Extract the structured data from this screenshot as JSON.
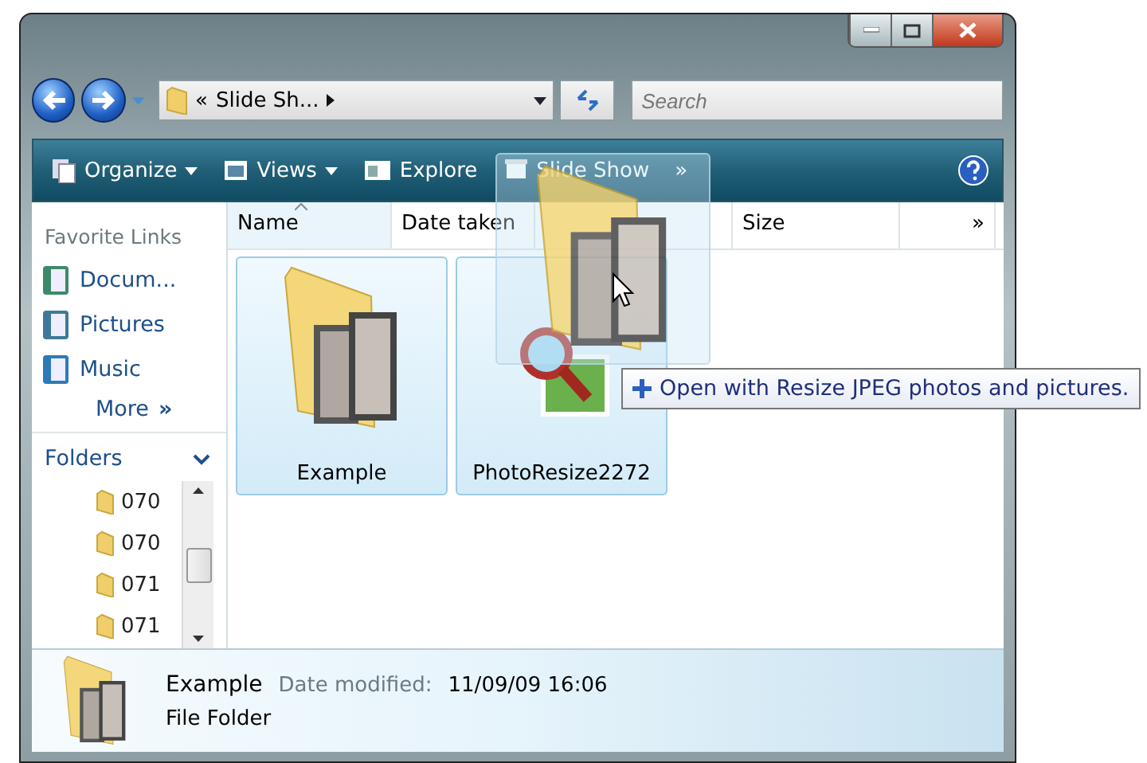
{
  "address": {
    "overflow": "«",
    "crumb": "Slide Sh...",
    "placeholder": "Search"
  },
  "toolbar": {
    "buttons": [
      {
        "label": "Organize",
        "kind": "organize",
        "dropdown": true
      },
      {
        "label": "Views",
        "kind": "views",
        "dropdown": true
      },
      {
        "label": "Explore",
        "kind": "explore",
        "dropdown": false
      },
      {
        "label": "Slide Show",
        "kind": "slideshow",
        "dropdown": false
      }
    ],
    "more": "»"
  },
  "favorite_links": {
    "title": "Favorite Links",
    "items": [
      {
        "label": "Docum...",
        "kind": "documents"
      },
      {
        "label": "Pictures",
        "kind": "pictures"
      },
      {
        "label": "Music",
        "kind": "music"
      }
    ],
    "more": "More",
    "more_glyph": "»"
  },
  "folders": {
    "title": "Folders",
    "expanded": true,
    "items": [
      "070",
      "070",
      "071",
      "071"
    ]
  },
  "columns": [
    {
      "label": "Name",
      "sorted": true
    },
    {
      "label": "Date taken",
      "sorted": false
    },
    {
      "label": "Size",
      "sorted": false
    }
  ],
  "columns_more": "»",
  "items": [
    {
      "name": "Example",
      "kind": "folder",
      "selected": true
    },
    {
      "name": "PhotoResize2272",
      "kind": "program",
      "selected": true
    }
  ],
  "drag": {
    "tooltip": "Open with Resize JPEG photos and pictures."
  },
  "details": {
    "name": "Example",
    "date_label": "Date modified:",
    "date": "11/09/09 16:06",
    "type": "File Folder"
  }
}
